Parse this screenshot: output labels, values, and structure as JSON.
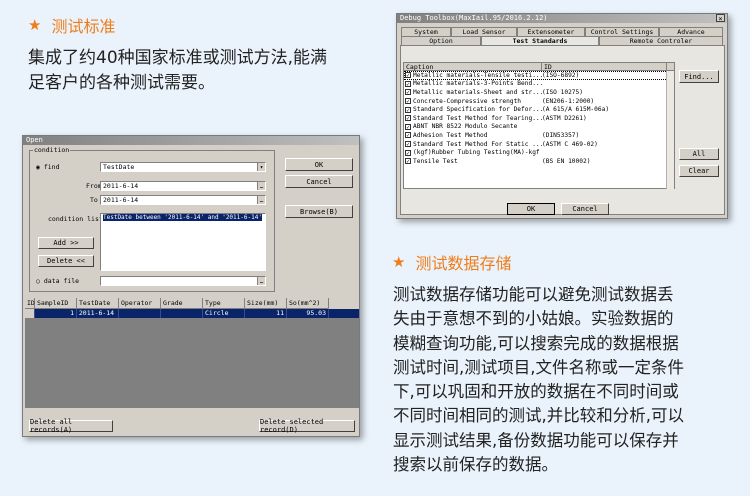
{
  "left_section": {
    "heading": "测试标准",
    "paragraph_line1": "集成了约40种国家标准或测试方法,能满",
    "paragraph_line2": "足客户的各种测试需要。"
  },
  "right_section": {
    "heading": "测试数据存储",
    "lines": [
      "测试数据存储功能可以避免测试数据丢",
      "失由于意想不到的小姑娘。实验数据的",
      "模糊查询功能,可以搜索完成的数据根据",
      "测试时间,测试项目,文件名称或一定条件",
      "下,可以巩固和开放的数据在不同时间或",
      "不同时间相同的测试,并比较和分析,可以",
      "显示测试结果,备份数据功能可以保存并",
      "搜索以前保存的数据。"
    ]
  },
  "open_dialog": {
    "title": "Open",
    "group_label": "condition",
    "find_label": "find",
    "find_value": "TestDate",
    "from_label": "From",
    "from_value": "2011-6-14",
    "to_label": "To",
    "to_value": "2011-6-14",
    "condition_list_label": "condition list",
    "condition_list_value": "TestDate between '2011-6-14' and '2011-6-14'",
    "add_button": "Add >>",
    "delete_button": "Delete <<",
    "data_file_label": "data file",
    "ok_button": "OK",
    "cancel_button": "Cancel",
    "browse_button": "Browse(B)",
    "grid_columns": [
      "ID",
      "SampleID",
      "TestDate",
      "Operator",
      "Grade",
      "Type",
      "Size(mm)",
      "So(mm^2)"
    ],
    "grid_row": [
      "",
      "1",
      "2011-6-14",
      "",
      "",
      "Circle",
      "11",
      "95.03"
    ],
    "delete_all_button": "Delete all records(A)",
    "delete_selected_button": "Delete selected record(D)"
  },
  "debug_dialog": {
    "title": "Debug Toolbox(MaxIail.95/2016.2.12)",
    "close_glyph": "×",
    "tabs_row1": [
      "System",
      "Load Sensor",
      "Extensometer",
      "Control Settings",
      "Advance"
    ],
    "tabs_row2": [
      "Option",
      "Test Standards",
      "Remote Controler"
    ],
    "list_headers": [
      "Caption",
      "ID"
    ],
    "rows": [
      {
        "caption": "Metallic materials-Tensile testi...",
        "id": "(ISO-6892)",
        "checked": true,
        "selected": true
      },
      {
        "caption": "Metallic materials-3-Points Bend...",
        "id": "",
        "checked": true,
        "selected": false
      },
      {
        "caption": "Metallic materials-Sheet and str...",
        "id": "(ISO 10275)",
        "checked": true,
        "selected": false
      },
      {
        "caption": "Concrete-Compressive strength",
        "id": "(EN206-1:2000)",
        "checked": true,
        "selected": false
      },
      {
        "caption": "Standard Specification for Defor...",
        "id": "(A 615/A 615M-06a)",
        "checked": true,
        "selected": false
      },
      {
        "caption": "Standard Test Method for Tearing...",
        "id": "(ASTM D2261)",
        "checked": true,
        "selected": false
      },
      {
        "caption": "ABNT NBR 8522 Modulo Secante",
        "id": "",
        "checked": true,
        "selected": false
      },
      {
        "caption": "Adhesion Test Method",
        "id": "(DIN53357)",
        "checked": true,
        "selected": false
      },
      {
        "caption": "Standard Test Method For Static ...",
        "id": "(ASTM C 469-02)",
        "checked": true,
        "selected": false
      },
      {
        "caption": "(kgf)Rubber Tubing Testing(MA)-kgf",
        "id": "",
        "checked": true,
        "selected": false
      },
      {
        "caption": "Tensile Test",
        "id": "(BS EN 10002)",
        "checked": true,
        "selected": false
      }
    ],
    "find_button": "Find...",
    "all_button": "All",
    "clear_button": "Clear",
    "ok_button": "OK",
    "cancel_button": "Cancel"
  }
}
